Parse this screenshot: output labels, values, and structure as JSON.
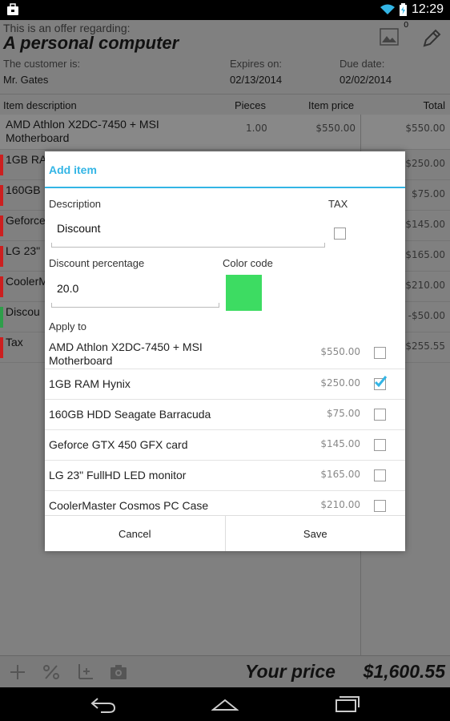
{
  "status_bar": {
    "time": "12:29"
  },
  "header": {
    "offer_label": "This is an offer regarding:",
    "offer_title": "A personal computer",
    "image_count": "0",
    "customer_label": "The customer is:",
    "customer_value": "Mr. Gates",
    "expires_label": "Expires on:",
    "expires_value": "02/13/2014",
    "due_label": "Due date:",
    "due_value": "02/02/2014"
  },
  "columns": {
    "description": "Item description",
    "pieces": "Pieces",
    "price": "Item price",
    "total": "Total"
  },
  "rows": [
    {
      "desc": "AMD Athlon X2DC-7450 + MSI Motherboard",
      "pieces": "1.00",
      "price": "$550.00",
      "total": "$550.00",
      "color": ""
    },
    {
      "desc": "1GB RA",
      "total": "$250.00",
      "color": "#cc1f1f"
    },
    {
      "desc": "160GB",
      "total": "$75.00",
      "color": "#cc1f1f"
    },
    {
      "desc": "Geforce",
      "total": "$145.00",
      "color": "#cc1f1f"
    },
    {
      "desc": "LG 23\"",
      "total": "$165.00",
      "color": "#cc1f1f"
    },
    {
      "desc": "CoolerM",
      "total": "$210.00",
      "color": "#cc1f1f"
    },
    {
      "desc": "Discou",
      "total": "-$50.00",
      "color": "#2e9e4a"
    },
    {
      "desc": "Tax",
      "total": "$255.55",
      "color": "#cc1f1f"
    }
  ],
  "bottom_bar": {
    "price_label": "Your price",
    "price_value": "$1,600.55"
  },
  "dialog": {
    "title": "Add item",
    "description_label": "Description",
    "description_value": "Discount",
    "tax_label": "TAX",
    "discount_label": "Discount percentage",
    "discount_value": "20.0",
    "color_label": "Color code",
    "color_value": "#3ddc62",
    "apply_label": "Apply to",
    "apply_items": [
      {
        "desc": "AMD Athlon X2DC-7450 + MSI Motherboard",
        "price": "$550.00",
        "checked": false
      },
      {
        "desc": "1GB RAM Hynix",
        "price": "$250.00",
        "checked": true
      },
      {
        "desc": "160GB HDD Seagate Barracuda",
        "price": "$75.00",
        "checked": false
      },
      {
        "desc": "Geforce GTX 450 GFX card",
        "price": "$145.00",
        "checked": false
      },
      {
        "desc": "LG 23\" FullHD LED monitor",
        "price": "$165.00",
        "checked": false
      },
      {
        "desc": "CoolerMaster Cosmos PC Case",
        "price": "$210.00",
        "checked": false
      }
    ],
    "cancel_label": "Cancel",
    "save_label": "Save"
  }
}
